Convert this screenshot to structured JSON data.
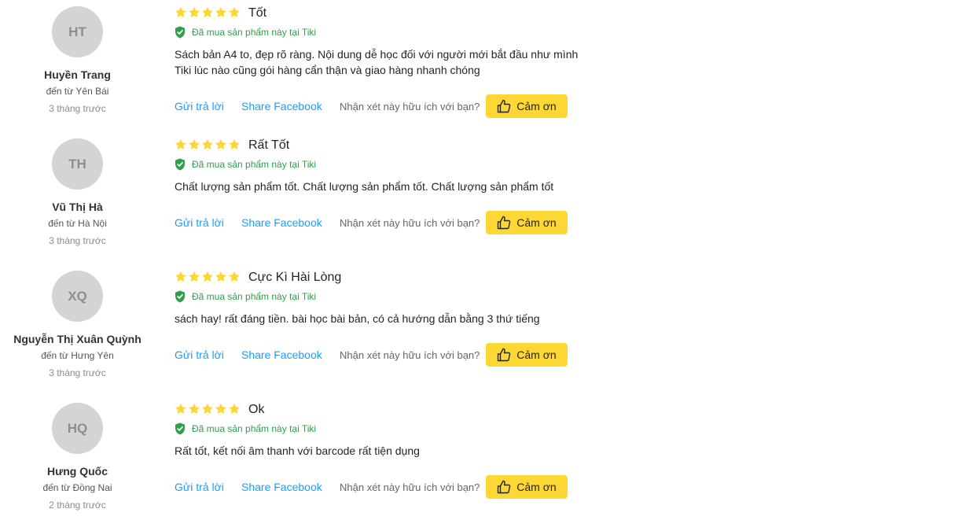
{
  "reviews": [
    {
      "initials": "HT",
      "name": "Huyền Trang",
      "from": "đến từ Yên Bái",
      "time": "3 tháng trước",
      "rating": 5,
      "title": "Tốt",
      "verified": "Đã mua sản phẩm này tại Tiki",
      "text_lines": [
        "Sách bản A4 to, đẹp rõ ràng. Nội dung dễ học đối với người mới bắt đầu như mình",
        "Tiki lúc nào cũng gói hàng cẩn thận và giao hàng nhanh chóng"
      ],
      "reply_label": "Gửi trả lời",
      "share_label": "Share Facebook",
      "helpful_label": "Nhận xét này hữu ích với bạn?",
      "thanks_label": "Cảm ơn"
    },
    {
      "initials": "TH",
      "name": "Vũ Thị Hà",
      "from": "đến từ Hà Nội",
      "time": "3 tháng trước",
      "rating": 5,
      "title": "Rất Tốt",
      "verified": "Đã mua sản phẩm này tại Tiki",
      "text_lines": [
        "Chất lượng sản phẩm tốt. Chất lượng sản phẩm tốt. Chất lượng sản phẩm tốt"
      ],
      "reply_label": "Gửi trả lời",
      "share_label": "Share Facebook",
      "helpful_label": "Nhận xét này hữu ích với bạn?",
      "thanks_label": "Cảm ơn"
    },
    {
      "initials": "XQ",
      "name": "Nguyễn Thị Xuân Quỳnh",
      "from": "đến từ Hưng Yên",
      "time": "3 tháng trước",
      "rating": 5,
      "title": "Cực Kì Hài Lòng",
      "verified": "Đã mua sản phẩm này tại Tiki",
      "text_lines": [
        "sách hay! rất đáng tiền. bài học bài bản, có cả hướng dẫn bằng 3 thứ tiếng"
      ],
      "reply_label": "Gửi trả lời",
      "share_label": "Share Facebook",
      "helpful_label": "Nhận xét này hữu ích với bạn?",
      "thanks_label": "Cảm ơn"
    },
    {
      "initials": "HQ",
      "name": "Hưng Quốc",
      "from": "đến từ Đồng Nai",
      "time": "2 tháng trước",
      "rating": 5,
      "title": "Ok",
      "verified": "Đã mua sản phẩm này tại Tiki",
      "text_lines": [
        "Rất tốt, kết nối âm thanh với barcode rất tiện dụng"
      ],
      "reply_label": "Gửi trả lời",
      "share_label": "Share Facebook",
      "helpful_label": "Nhận xét này hữu ích với bạn?",
      "thanks_label": "Cảm ơn"
    }
  ],
  "colors": {
    "star": "#fdd835",
    "verified": "#2ea04a",
    "link": "#189eff",
    "thanks_button": "#fdd835",
    "avatar_bg": "#d4d4d4"
  },
  "icons": {
    "star": "star-icon",
    "verified": "shield-check-icon",
    "thanks": "thumbs-up-icon"
  }
}
